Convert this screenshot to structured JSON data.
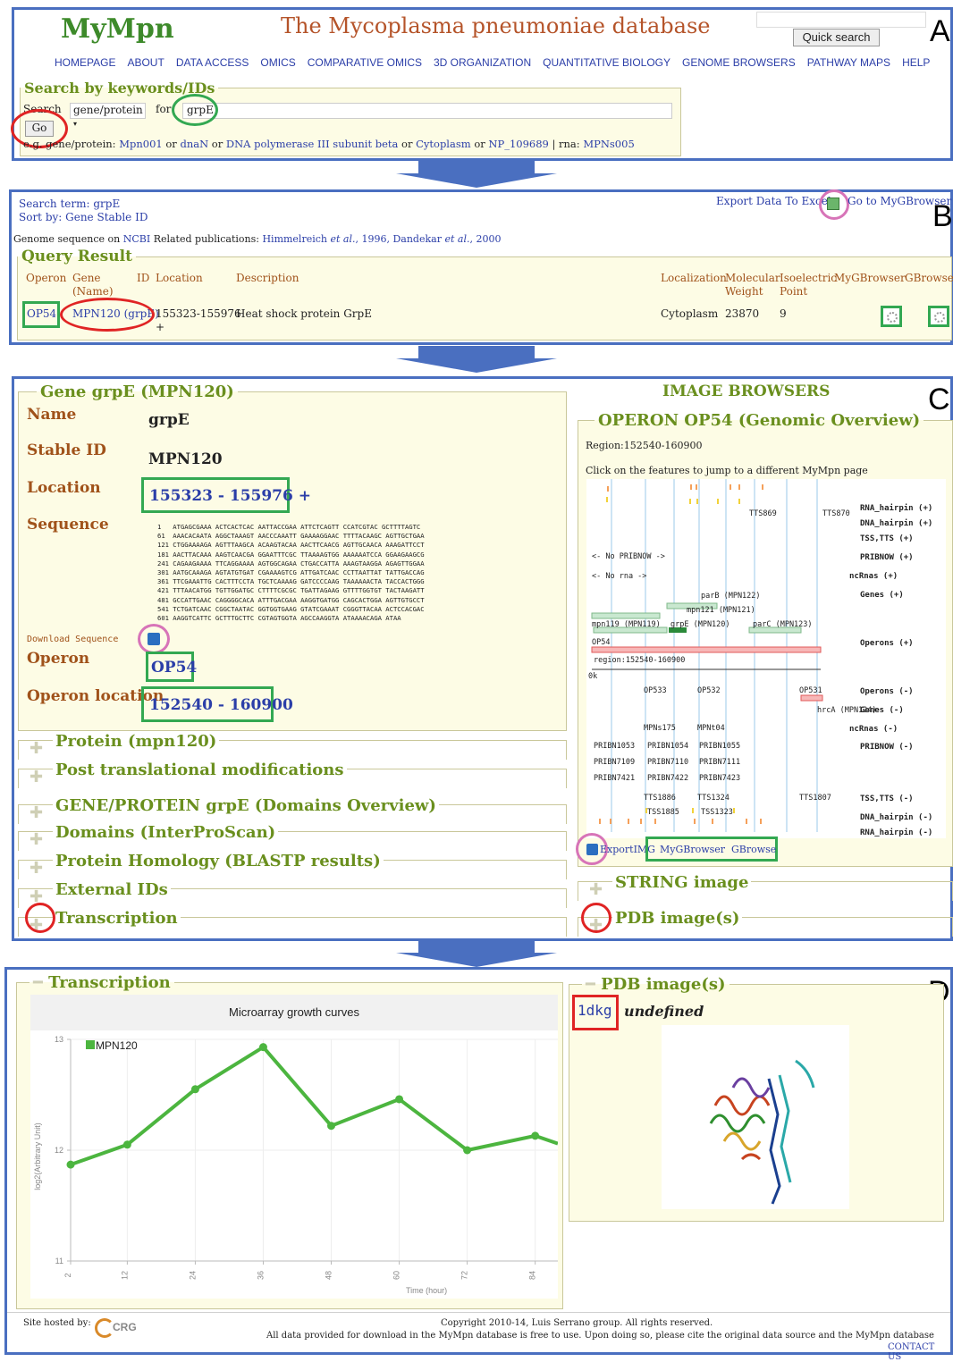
{
  "panelA": {
    "logo": "MyMpn",
    "site_title": "The Mycoplasma pneumoniae database",
    "quick_search_label": "Quick search",
    "letter": "A",
    "nav": [
      "HOMEPAGE",
      "ABOUT",
      "DATA ACCESS",
      "OMICS",
      "COMPARATIVE OMICS",
      "3D ORGANIZATION",
      "QUANTITATIVE BIOLOGY",
      "GENOME BROWSERS",
      "PATHWAY MAPS",
      "HELP"
    ],
    "search_legend": "Search by keywords/IDs",
    "search_label": "Search",
    "search_type": "gene/protein",
    "for_label": "for",
    "search_value": "grpE",
    "go_label": "Go",
    "eg_prefix": "e.g. gene/protein:",
    "eg_links": [
      "Mpn001",
      "dnaN",
      "DNA polymerase III subunit beta",
      "Cytoplasm",
      "NP_109689"
    ],
    "or_label": "or",
    "rna_label": "| rna:",
    "rna_link": "MPNs005"
  },
  "panelB": {
    "letter": "B",
    "search_term": "Search term: grpE",
    "sort_by": "Sort by: Gene Stable ID",
    "export": "Export Data To Excel",
    "goto": "Go to MyGBrowser",
    "genome_prefix": "Genome sequence on",
    "ncbi": "NCBI",
    "related": "Related publications:",
    "pub1_a": "Himmelreich",
    "pub1_b": "et al.",
    "pub1_c": ", 1996,",
    "pub2_a": "Dandekar",
    "pub2_b": "et al.",
    "pub2_c": ", 2000",
    "query_legend": "Query Result",
    "headers": [
      "Operon",
      "Gene (Name)",
      "ID",
      "Location",
      "Description",
      "Localization",
      "Molecular Weight",
      "Isoelectric Point",
      "MyGBrowser",
      "GBrowse"
    ],
    "row": {
      "operon": "OP54",
      "gene": "MPN120 (grpE)",
      "location": "155323-155976",
      "strand": "+",
      "description": "Heat shock protein GrpE",
      "localization": "Cytoplasm",
      "mw": "23870",
      "pi": "9"
    }
  },
  "panelC": {
    "letter": "C",
    "gene_legend": "Gene grpE (MPN120)",
    "name_label": "Name",
    "name_value": "grpE",
    "stable_label": "Stable ID",
    "stable_value": "MPN120",
    "location_label": "Location",
    "location_value": "155323 - 155976 +",
    "sequence_label": "Sequence",
    "sequence": [
      "1   ATGAGCGAAA ACTCACTCAC AATTACCGAA ATTCTCAGTT CCATCGTAC GCTTTTAGTC",
      "61  AAACACAATA AGGCTAAAGT AACCCAAATT GAAAAGGAAC TTTTACAAGC AGTTGCTGAA",
      "121 CTGGAAAAGA AGTTTAAGCA ACAAGTACAA AACTTCAACG AGTTGCAACA AAAGATTCCT",
      "181 AACTTACAAA AAGTCAACGA GGAATTTCGC TTAAAAGTGG AAAAAATCCA GGAAGAAGCG",
      "241 CAGAAGAAAA TTCAGGAAAA AGTGGCAGAA CTGACCATTA AAAGTAAGGA AGAGTTGGAA",
      "301 AATGCAAAGA AGTATGTGAT CGAAAAGTCG ATTGATCAAC CCTTAATTAT TATTGACCAG",
      "361 TTCGAAATTG CACTTTCCTA TGCTCAAAAG GATCCCCAAG TAAAAAACTA TACCACTGGG",
      "421 TTTAACATGG TGTTGGATGC CTTTTCGCGC TGATTAGAAG GTTTTGGTGT TACTAAGATT",
      "481 GCCATTGAAC CAGGGGCACA ATTTGACGAA AAGGTGATGG CAGCACTGGA AGTTGTGCCT",
      "541 TCTGATCAAC CGGCTAATAC GGTGGTGAAG GTATCGAAAT CGGGTTACAA ACTCCACGAC",
      "601 AAGGTCATTC GCTTTGCTTC CGTAGTGGTA AGCCAAGGTA ATAAAACAGA ATAA"
    ],
    "download_label": "Download Sequence",
    "operon_label": "Operon",
    "operon_value": "OP54",
    "operon_loc_label": "Operon location",
    "operon_loc_value": "152540 - 160900",
    "sections": [
      "Protein (mpn120)",
      "Post translational modifications",
      "GENE/PROTEIN grpE (Domains Overview)",
      "Domains (InterProScan)",
      "Protein Homology (BLASTP results)",
      "External IDs",
      "Transcription"
    ],
    "image_browsers": "IMAGE BROWSERS",
    "operon_legend": "OPERON OP54 (Genomic Overview)",
    "region": "Region:152540-160900",
    "click_note": "Click on the features to jump to a different MyMpn page",
    "export_img": "ExportIMG",
    "mygb": "MyGBrowser",
    "gbrowse": "GBrowse",
    "string_image": "STRING image",
    "pdb_images": "PDB image(s)",
    "tracks_right": [
      "RNA_hairpin (+)",
      "DNA_hairpin (+)",
      "TSS,TTS (+)",
      "PRIBNOW (+)",
      "ncRnas (+)",
      "Genes (+)",
      "Operons (+)",
      "Operons (-)",
      "Genes (-)",
      "ncRnas (-)",
      "PRIBNOW (-)",
      "TSS,TTS (-)",
      "DNA_hairpin (-)",
      "RNA_hairpin (-)"
    ],
    "gb_labels": {
      "tts869": "TTS869",
      "tts870": "TTS870",
      "no_pribnow": "<- No PRIBNOW ->",
      "no_rna": "<- No rna ->",
      "parB": "parB (MPN122)",
      "mpn121": "mpn121 (MPN121)",
      "mpn119": "mpn119 (MPN119)",
      "grpE": "grpE (MPN120)",
      "parC": "parC (MPN123)",
      "op54": "OP54",
      "region": "region:152540-160900",
      "ok": "0k",
      "op533": "OP533",
      "op532": "OP532",
      "op531": "OP531",
      "hrcA": "hrcA (MPN124)",
      "mpns175": "MPNs175",
      "mpnt04": "MPNt04",
      "p1053": "PRIBN1053",
      "p1054": "PRIBN1054",
      "p1055": "PRIBN1055",
      "p7109": "PRIBN7109",
      "p7110": "PRIBN7110",
      "p7111": "PRIBN7111",
      "p7421": "PRIBN7421",
      "p7422": "PRIBN7422",
      "p7423": "PRIBN7423",
      "tts1886": "TTS1886",
      "tts1324": "TTS1324",
      "tts1807": "TTS1807",
      "tss1885": "TSS1885",
      "tss1323": "TSS1323"
    }
  },
  "panelD": {
    "letter": "D",
    "transcription_legend": "Transcription",
    "pdb_legend": "PDB image(s)",
    "pdb_id": "1dkg",
    "pdb_desc": "undefined"
  },
  "chart_data": {
    "type": "line",
    "title": "Microarray growth curves",
    "xlabel": "Time (hour)",
    "ylabel": "log2(Arbitrary Unit)",
    "x_ticks": [
      "2",
      "12",
      "24",
      "36",
      "48",
      "60",
      "72",
      "84"
    ],
    "y_ticks": [
      "11",
      "12",
      "13"
    ],
    "ylim": [
      11,
      13
    ],
    "xlim": [
      2,
      88
    ],
    "series": [
      {
        "name": "MPN120",
        "color": "#4cb53f",
        "x": [
          2,
          12,
          24,
          36,
          48,
          60,
          72,
          84,
          88
        ],
        "y": [
          11.87,
          12.05,
          12.55,
          12.93,
          12.22,
          12.46,
          12.0,
          12.13,
          12.06
        ]
      }
    ],
    "legend": "top-left",
    "grid": true
  },
  "footer": {
    "hosted": "Site hosted by:",
    "crg": "CRG",
    "copyright": "Copyright 2010-14, Luis Serrano group. All rights reserved.",
    "notice": "All data provided for download in the MyMpn database is free to use. Upon doing so, please cite the original data source and the MyMpn database",
    "contact": "CONTACT US"
  }
}
